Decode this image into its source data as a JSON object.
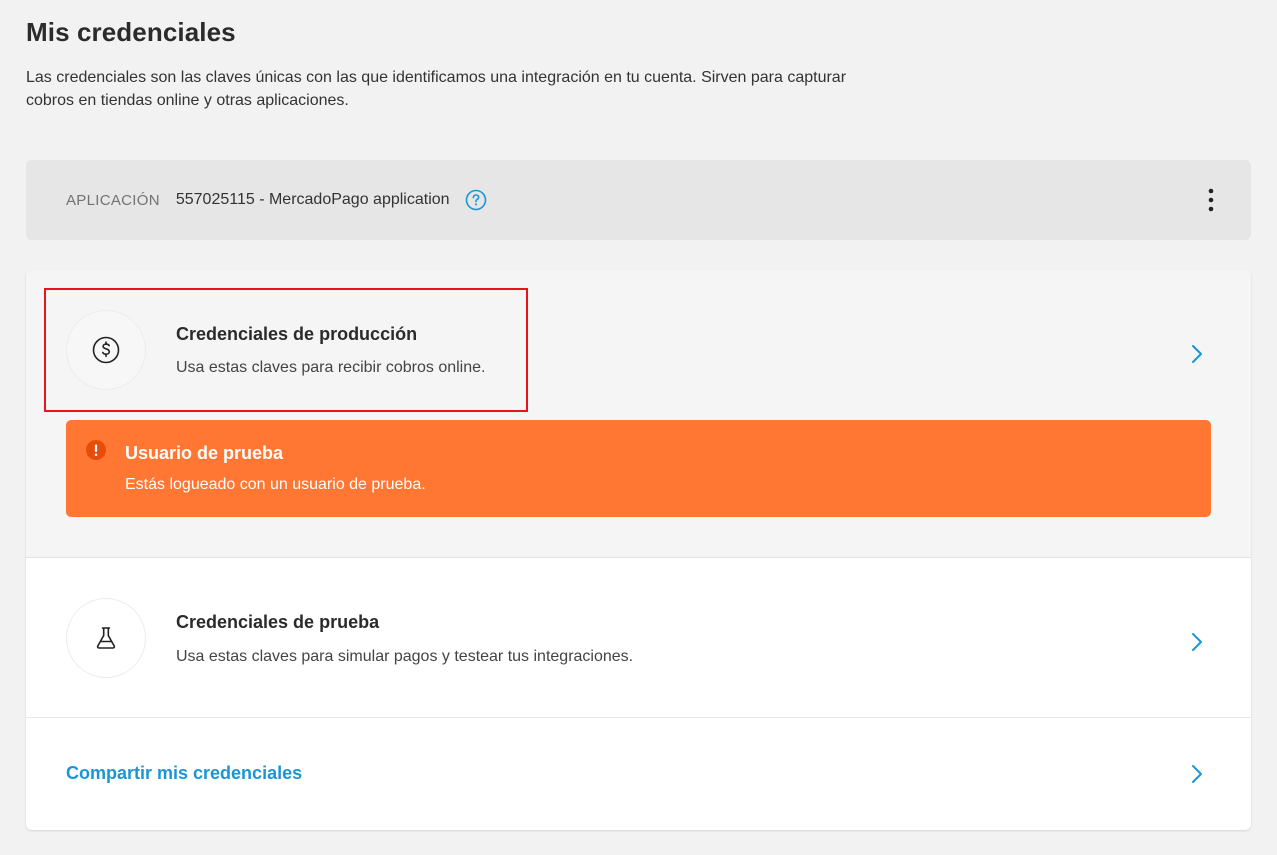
{
  "page": {
    "title": "Mis credenciales",
    "description": "Las credenciales son las claves únicas con las que identificamos una integración en tu cuenta. Sirven para capturar cobros en tiendas online y otras aplicaciones."
  },
  "application": {
    "label": "APLICACIÓN",
    "value": "557025115 - MercadoPago application",
    "help_icon": "question-circle-icon",
    "menu_icon": "more-vertical-icon"
  },
  "production": {
    "title": "Credenciales de producción",
    "subtitle": "Usa estas claves para recibir cobros online.",
    "icon": "dollar-circle-icon"
  },
  "alert": {
    "title": "Usuario de prueba",
    "text": "Estás logueado con un usuario de prueba.",
    "icon": "exclamation-circle-icon",
    "color": "#ff7733"
  },
  "test": {
    "title": "Credenciales de prueba",
    "subtitle": "Usa estas claves para simular pagos y testear tus integraciones.",
    "icon": "flask-icon"
  },
  "share": {
    "label": "Compartir mis credenciales"
  },
  "colors": {
    "accent": "#1a96d4",
    "warning": "#ff7733",
    "highlight": "#e8131b"
  }
}
